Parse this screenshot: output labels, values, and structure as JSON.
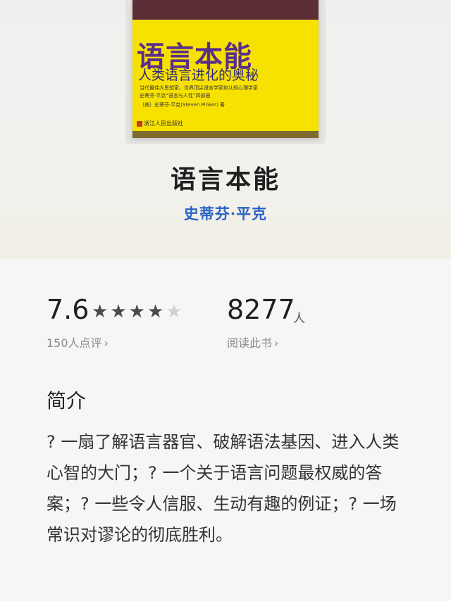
{
  "cover": {
    "title": "语言本能",
    "subtitle": "人类语言进化的奥秘",
    "line1": "当代最伟大思想家、世界顶尖语言学家和认知心理学家",
    "line2": "史蒂芬·平克“语言与人性”四部曲",
    "line3": "〔美〕史蒂芬·平克(Steven Pinker) 著",
    "publisher": "浙江人民出版社"
  },
  "book": {
    "title": "语言本能",
    "author": "史蒂芬·平克"
  },
  "rating": {
    "score": "7.6",
    "stars_filled": 4,
    "stars_total": 5,
    "reviews_label": "150人点评",
    "chevron": "›"
  },
  "readers": {
    "count": "8277",
    "unit": "人",
    "label": "阅读此书",
    "chevron": "›"
  },
  "intro": {
    "heading": "简介",
    "text": "? 一扇了解语言器官、破解语法基因、进入人类心智的大门；? 一个关于语言问题最权威的答案；? 一些令人信服、生动有趣的例证；? 一场常识对谬论的彻底胜利。"
  },
  "colors": {
    "author": "#2b63c4",
    "cover_bg": "#f6e100",
    "star_filled": "#4a4a4a",
    "star_empty": "#d0d0d0"
  }
}
